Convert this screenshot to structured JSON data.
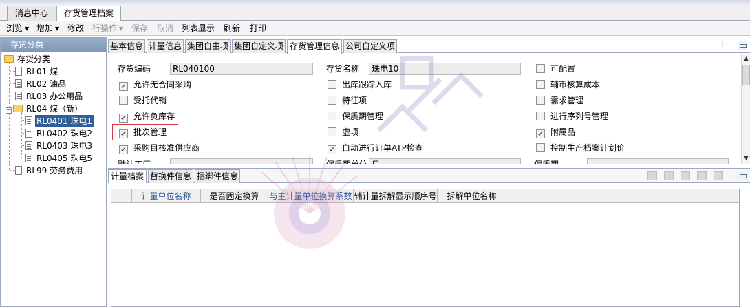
{
  "top_tabs": [
    {
      "label": "消息中心"
    },
    {
      "label": "存货管理档案",
      "active": true
    }
  ],
  "toolbar": {
    "browse": "浏览",
    "add": "增加",
    "modify": "修改",
    "row_op": "行操作",
    "save": "保存",
    "cancel": "取消",
    "list_view": "列表显示",
    "refresh": "刷新",
    "print": "打印"
  },
  "left_panel": {
    "title": "存货分类",
    "tree": [
      {
        "label": "存货分类",
        "type": "folder",
        "level": 0
      },
      {
        "label": "RL01 煤",
        "type": "doc",
        "level": 1
      },
      {
        "label": "RL02 油品",
        "type": "doc",
        "level": 1
      },
      {
        "label": "RL03 办公用品",
        "type": "doc",
        "level": 1
      },
      {
        "label": "RL04 煤（新）",
        "type": "folder",
        "level": 1
      },
      {
        "label": "RL0401 珠电1",
        "type": "doc",
        "level": 2,
        "selected": true
      },
      {
        "label": "RL0402 珠电2",
        "type": "doc",
        "level": 2
      },
      {
        "label": "RL0403 珠电3",
        "type": "doc",
        "level": 2
      },
      {
        "label": "RL0405 珠电5",
        "type": "doc",
        "level": 2
      },
      {
        "label": "RL99 劳务费用",
        "type": "doc",
        "level": 1
      }
    ]
  },
  "sub_tabs": [
    {
      "label": "基本信息"
    },
    {
      "label": "计量信息"
    },
    {
      "label": "集团自由项"
    },
    {
      "label": "集团自定义项"
    },
    {
      "label": "存货管理信息",
      "active": true
    },
    {
      "label": "公司自定义项"
    }
  ],
  "form": {
    "code_label": "存货编码",
    "code_value": "RL040100",
    "name_label": "存货名称",
    "name_value": "珠电10",
    "default_factory_label": "默认工厂",
    "shelf_unit_label": "保质期单位",
    "shelf_unit_value": "日",
    "shelf_period_label": "保质期",
    "col1": [
      {
        "label": "允许无合同采购",
        "checked": true
      },
      {
        "label": "受托代销",
        "checked": false
      },
      {
        "label": "允许负库存",
        "checked": true
      },
      {
        "label": "批次管理",
        "checked": true
      },
      {
        "label": "采购目核准供应商",
        "checked": true
      }
    ],
    "col2": [
      {
        "label": "出库跟踪入库",
        "checked": false
      },
      {
        "label": "特征项",
        "checked": false
      },
      {
        "label": "保质期管理",
        "checked": false
      },
      {
        "label": "虚项",
        "checked": false
      },
      {
        "label": "自动进行订单ATP检查",
        "checked": true
      }
    ],
    "col3": [
      {
        "label": "可配置",
        "checked": false
      },
      {
        "label": "辅币核算成本",
        "checked": false
      },
      {
        "label": "需求管理",
        "checked": false
      },
      {
        "label": "进行序列号管理",
        "checked": false
      },
      {
        "label": "附属品",
        "checked": true
      },
      {
        "label": "控制生产档案计划价",
        "checked": false
      }
    ]
  },
  "bottom_tabs": [
    {
      "label": "计量档案",
      "active": true
    },
    {
      "label": "替换件信息"
    },
    {
      "label": "捆绑件信息"
    }
  ],
  "table_columns": [
    "计量单位名称",
    "是否固定换算",
    "与主计量单位换算系数",
    "辅计量拆解显示顺序号",
    "拆解单位名称"
  ],
  "colors": {
    "accent": "#2f5e9a",
    "highlight": "#d43b3b",
    "panel_header": "#8aa2c2"
  }
}
